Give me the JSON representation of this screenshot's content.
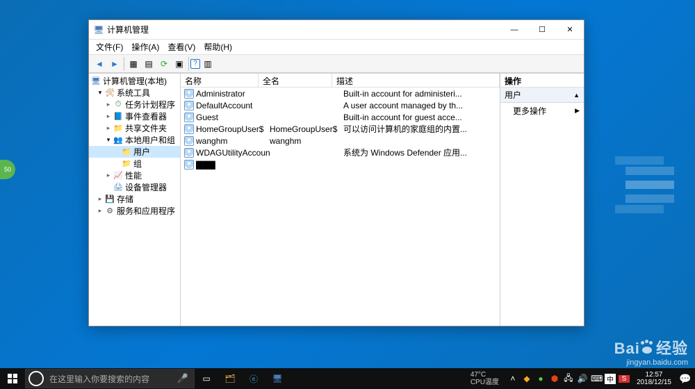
{
  "window": {
    "title": "计算机管理",
    "controls": {
      "min": "—",
      "max": "☐",
      "close": "✕"
    }
  },
  "menubar": [
    "文件(F)",
    "操作(A)",
    "查看(V)",
    "帮助(H)"
  ],
  "tree": {
    "root": "计算机管理(本地)",
    "items": [
      {
        "depth": 1,
        "label": "系统工具",
        "icon": "wrench-icon",
        "expand": "open"
      },
      {
        "depth": 2,
        "label": "任务计划程序",
        "icon": "clock-icon",
        "expand": "closed"
      },
      {
        "depth": 2,
        "label": "事件查看器",
        "icon": "book-icon",
        "expand": "closed"
      },
      {
        "depth": 2,
        "label": "共享文件夹",
        "icon": "folder-share-icon",
        "expand": "closed"
      },
      {
        "depth": 2,
        "label": "本地用户和组",
        "icon": "group-icon",
        "expand": "open"
      },
      {
        "depth": 3,
        "label": "用户",
        "icon": "folder-icon",
        "selected": true
      },
      {
        "depth": 3,
        "label": "组",
        "icon": "folder-icon"
      },
      {
        "depth": 2,
        "label": "性能",
        "icon": "perf-icon",
        "expand": "closed"
      },
      {
        "depth": 2,
        "label": "设备管理器",
        "icon": "device-icon"
      },
      {
        "depth": 1,
        "label": "存储",
        "icon": "disk-icon",
        "expand": "closed"
      },
      {
        "depth": 1,
        "label": "服务和应用程序",
        "icon": "service-icon",
        "expand": "closed"
      }
    ]
  },
  "list": {
    "columns": {
      "name": "名称",
      "fullname": "全名",
      "desc": "描述"
    },
    "rows": [
      {
        "name": "Administrator",
        "fullname": "",
        "desc": "Built-in account for administeri..."
      },
      {
        "name": "DefaultAccount",
        "fullname": "",
        "desc": "A user account managed by th..."
      },
      {
        "name": "Guest",
        "fullname": "",
        "desc": "Built-in account for guest acce..."
      },
      {
        "name": "HomeGroupUser$",
        "fullname": "HomeGroupUser$",
        "desc": "可以访问计算机的家庭组的内置..."
      },
      {
        "name": "wanghm",
        "fullname": "wanghm",
        "desc": ""
      },
      {
        "name": "WDAGUtilityAccount",
        "fullname": "",
        "desc": "系统为 Windows Defender 应用..."
      },
      {
        "name": "▇▇▇",
        "fullname": "",
        "desc": ""
      }
    ]
  },
  "actions": {
    "header": "操作",
    "group": "用户",
    "more": "更多操作"
  },
  "taskbar": {
    "search_placeholder": "在这里输入你要搜索的内容",
    "temp_line1": "47°C",
    "temp_line2": "CPU温度",
    "time": "12:57",
    "date": "2018/12/15"
  },
  "watermark": {
    "brand1": "Bai",
    "brand2": "经验",
    "url": "jingyan.baidu.com"
  },
  "badge": "50"
}
